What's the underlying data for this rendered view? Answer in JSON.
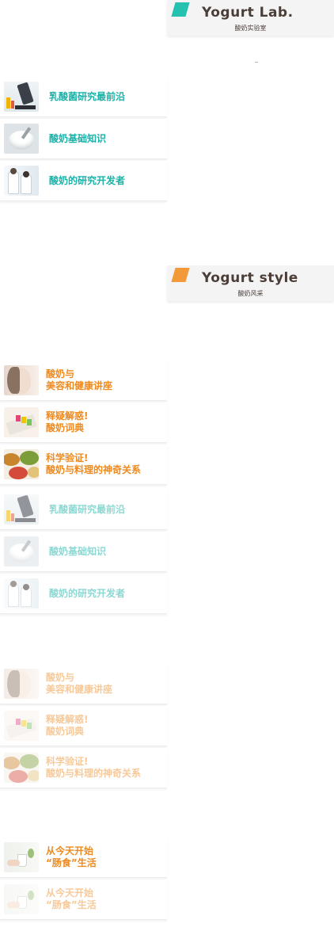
{
  "lab_section": {
    "title": "Yogurt Lab.",
    "subtitle": "酸奶实验室",
    "items": [
      {
        "label_lines": [
          "乳酸菌研究最前沿"
        ],
        "thumb": "microscope-photo"
      },
      {
        "label_lines": [
          "酸奶基础知识"
        ],
        "thumb": "yogurt-bowl-photo"
      },
      {
        "label_lines": [
          "酸奶的研究开发者"
        ],
        "thumb": "researchers-photo"
      }
    ]
  },
  "style_section": {
    "title": "Yogurt style",
    "subtitle": "酸奶风采",
    "items": [
      {
        "label_lines": [
          "酸奶与",
          "美容和健康讲座"
        ],
        "thumb": "beauty-photo"
      },
      {
        "label_lines": [
          "释疑解惑!",
          "酸奶词典"
        ],
        "thumb": "dictionary-photo"
      },
      {
        "label_lines": [
          "科学验证!",
          "酸奶与料理的神奇关系"
        ],
        "thumb": "food-photo"
      }
    ]
  },
  "lab_section_faded": {
    "items": [
      {
        "label_lines": [
          "乳酸菌研究最前沿"
        ]
      },
      {
        "label_lines": [
          "酸奶基础知识"
        ]
      },
      {
        "label_lines": [
          "酸奶的研究开发者"
        ]
      }
    ]
  },
  "style_section_faded": {
    "items": [
      {
        "label_lines": [
          "酸奶与",
          "美容和健康讲座"
        ]
      },
      {
        "label_lines": [
          "释疑解惑!",
          "酸奶词典"
        ]
      },
      {
        "label_lines": [
          "科学验证!",
          "酸奶与料理的神奇关系"
        ]
      }
    ]
  },
  "gut_life": {
    "items": [
      {
        "label_lines": [
          "从今天开始",
          "“肠食”生活"
        ],
        "thumb": "breakfast-photo"
      },
      {
        "label_lines": [
          "从今天开始",
          "“肠食”生活"
        ],
        "thumb": "breakfast-photo"
      }
    ]
  },
  "colors": {
    "teal": "#1ab3a9",
    "orange": "#ee8a1f",
    "lab_flag": "#25c1b0",
    "style_flag": "#f29a3a",
    "header_bg": "#f4f4f4",
    "title_text": "#4b3d37"
  }
}
